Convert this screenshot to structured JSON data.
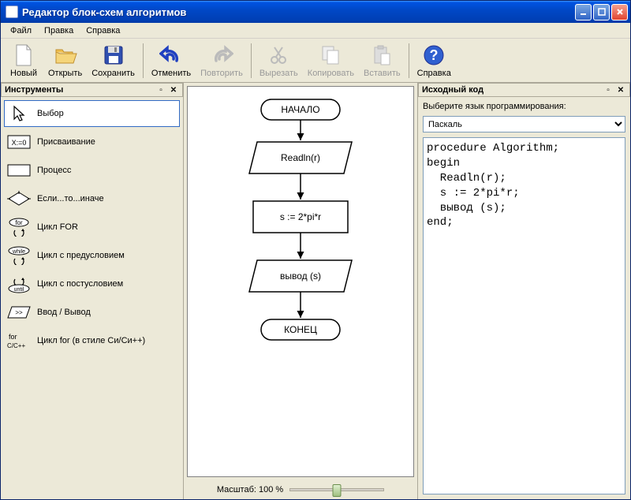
{
  "window": {
    "title": "Редактор блок-схем алгоритмов"
  },
  "menu": {
    "file": "Файл",
    "edit": "Правка",
    "help": "Справка"
  },
  "toolbar": {
    "new": "Новый",
    "open": "Открыть",
    "save": "Сохранить",
    "undo": "Отменить",
    "redo": "Повторить",
    "cut": "Вырезать",
    "copy": "Копировать",
    "paste": "Вставить",
    "help": "Справка"
  },
  "panels": {
    "tools": "Инструменты",
    "source": "Исходный код"
  },
  "tools": {
    "select": "Выбор",
    "assign": "Присваивание",
    "process": "Процесс",
    "ifelse": "Если...то...иначе",
    "for": "Цикл FOR",
    "while": "Цикл с предусловием",
    "until": "Цикл с постусловием",
    "io": "Ввод / Вывод",
    "cfor": "Цикл for (в стиле Си/Си++)"
  },
  "flowchart": {
    "start": "НАЧАЛО",
    "read": "Readln(r)",
    "calc": "s := 2*pi*r",
    "output": "вывод (s)",
    "end": "КОНЕЦ"
  },
  "zoom": {
    "label": "Масштаб: 100 %"
  },
  "source": {
    "lang_label": "Выберите язык программирования:",
    "lang_selected": "Паскаль",
    "code": "procedure Algorithm;\nbegin\n  Readln(r);\n  s := 2*pi*r;\n  вывод (s);\nend;"
  }
}
